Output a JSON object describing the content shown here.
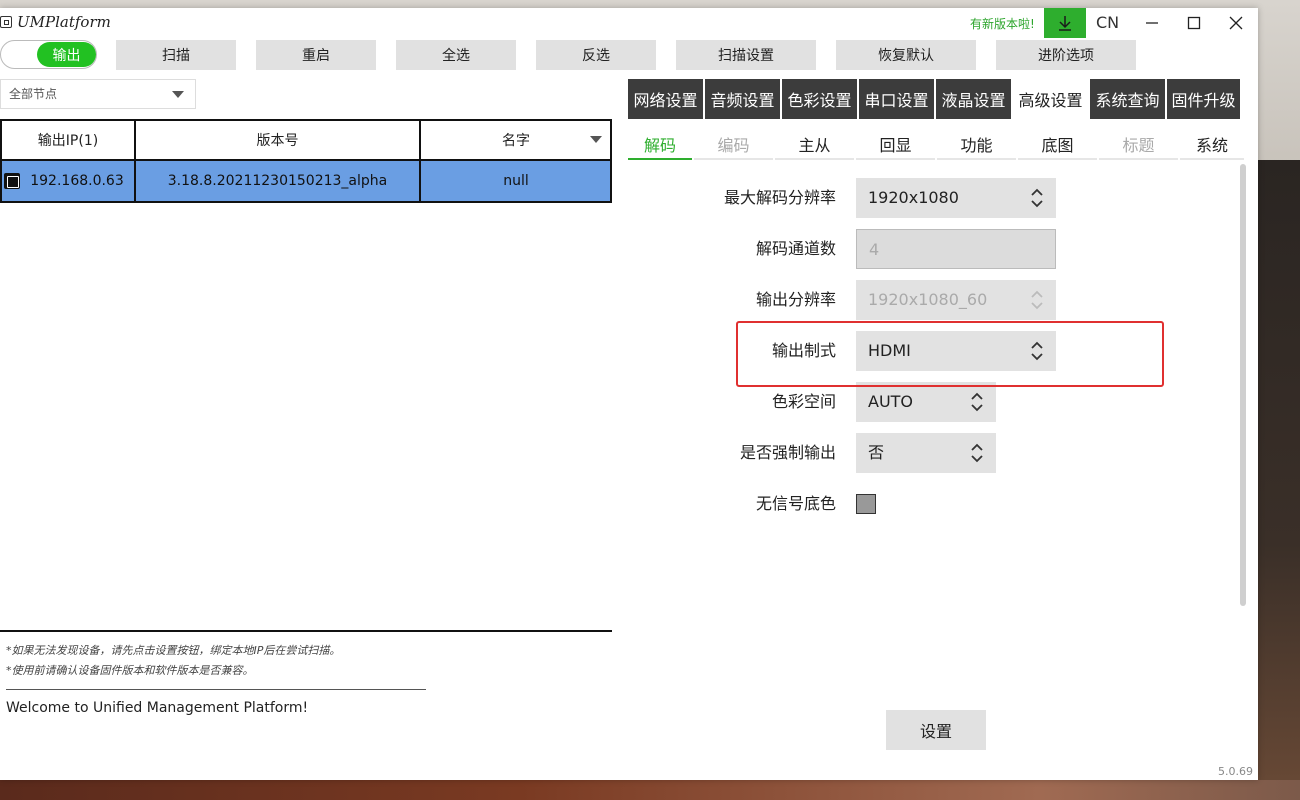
{
  "app": {
    "title": "UMPlatform",
    "new_version_notice": "有新版本啦!",
    "language": "CN"
  },
  "toolbar": {
    "toggle_label": "输出",
    "buttons": [
      "扫描",
      "重启",
      "全选",
      "反选",
      "扫描设置",
      "恢复默认",
      "进阶选项"
    ]
  },
  "node_filter": {
    "selected": "全部节点"
  },
  "device_table": {
    "headers": [
      "输出IP(1)",
      "版本号",
      "名字"
    ],
    "rows": [
      {
        "ip": "192.168.0.63",
        "version": "3.18.8.20211230150213_alpha",
        "name": "null",
        "selected": true
      }
    ]
  },
  "hints": [
    "*如果无法发现设备，请先点击设置按钮，绑定本地IP后在尝试扫描。",
    "*使用前请确认设备固件版本和软件版本是否兼容。"
  ],
  "welcome": "Welcome to Unified Management Platform!",
  "main_tabs": [
    "网络设置",
    "音频设置",
    "色彩设置",
    "串口设置",
    "液晶设置",
    "高级设置",
    "系统查询",
    "固件升级"
  ],
  "main_tab_active": "高级设置",
  "sub_tabs": [
    "解码",
    "编码",
    "主从",
    "回显",
    "功能",
    "底图",
    "标题",
    "系统"
  ],
  "sub_tab_active": "解码",
  "decode_settings": {
    "max_resolution": {
      "label": "最大解码分辨率",
      "value": "1920x1080"
    },
    "channels": {
      "label": "解码通道数",
      "value": "4"
    },
    "output_resolution": {
      "label": "输出分辨率",
      "value": "1920x1080_60"
    },
    "output_format": {
      "label": "输出制式",
      "value": "HDMI"
    },
    "color_space": {
      "label": "色彩空间",
      "value": "AUTO"
    },
    "force_output": {
      "label": "是否强制输出",
      "value": "否"
    },
    "no_signal_color": {
      "label": "无信号底色",
      "value": "#999999"
    }
  },
  "apply_button": "设置",
  "version": "5.0.69",
  "colors": {
    "accent_green": "#2eae2e",
    "selected_row": "#6a9ee3",
    "highlight_red": "#e03030",
    "dark_tab": "#3c3c3c"
  }
}
